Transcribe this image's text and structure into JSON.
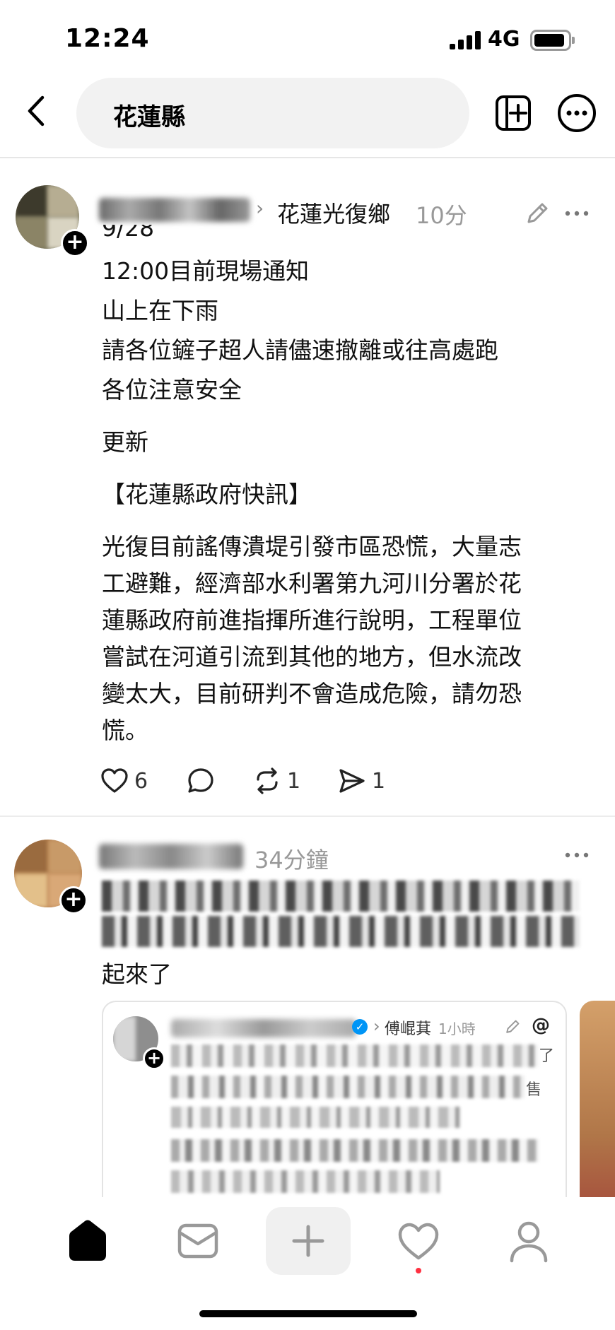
{
  "status": {
    "time": "12:24",
    "network": "4G"
  },
  "header": {
    "search_query": "花蓮縣"
  },
  "posts": [
    {
      "location": "花蓮光復鄉",
      "time": "10分",
      "lines": [
        "9/28",
        "12:00目前現場通知",
        "山上在下雨",
        "請各位鏟子超人請儘速撤離或往高處跑",
        "各位注意安全"
      ],
      "update_label": "更新",
      "bulletin_title": "【花蓮縣政府快訊】",
      "bulletin_lines": [
        "光復目前謠傳潰堤引發市區恐慌，大量志",
        "工避難，經濟部水利署第九河川分署於花",
        "蓮縣政府前進指揮所進行說明，工程單位",
        "嘗試在河道引流到其他的地方，但水流改",
        "變太大，目前研判不會造成危險，請勿恐",
        "慌。"
      ],
      "likes": "6",
      "reposts": "1",
      "shares": "1"
    },
    {
      "time": "34分鐘",
      "visible_text_fragment": "起來了",
      "quoted": {
        "author_tag": "傅崐萁",
        "time": "1小時",
        "fragment_a": "了",
        "fragment_b": "售"
      }
    }
  ],
  "icons": {
    "back": "chevron-left-icon",
    "add": "add-square-icon",
    "more": "more-circle-icon",
    "like": "heart-icon",
    "comment": "comment-icon",
    "repost": "repost-icon",
    "share": "send-icon"
  },
  "colors": {
    "accent": "#000000",
    "muted": "#999999",
    "notification": "#ff3040",
    "verified": "#0095f6"
  }
}
